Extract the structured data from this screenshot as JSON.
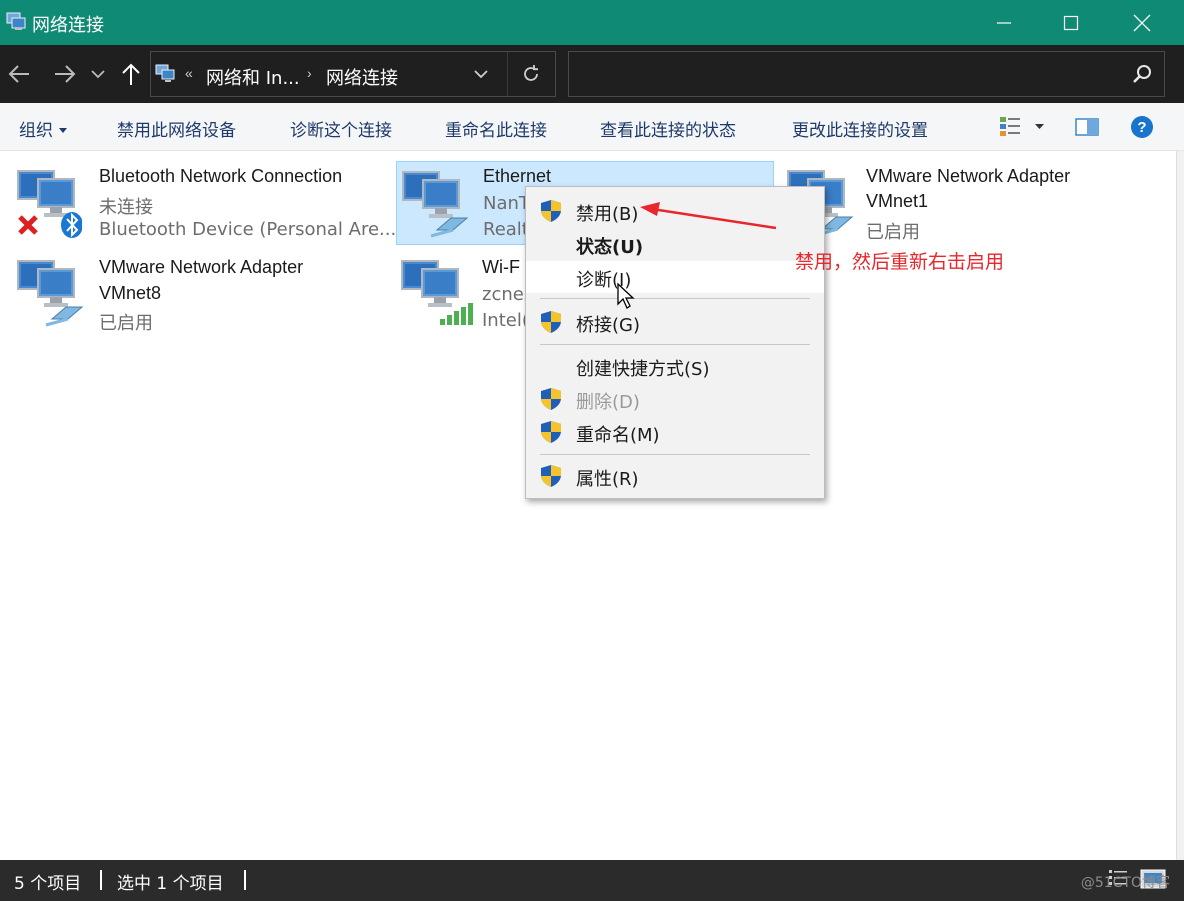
{
  "window": {
    "title": "网络连接",
    "accent": "#0f8a74"
  },
  "address": {
    "sep": "«",
    "segment1": "网络和 In...",
    "arrow": "›",
    "segment2": "网络连接",
    "search_placeholder": ""
  },
  "commands": {
    "organize": "组织",
    "disable_device": "禁用此网络设备",
    "diagnose": "诊断这个连接",
    "rename": "重命名此连接",
    "view_status": "查看此连接的状态",
    "change_settings": "更改此连接的设置"
  },
  "items": [
    {
      "name": "Bluetooth Network Connection",
      "status": "未连接",
      "device": "Bluetooth Device (Personal Are...",
      "icon": "bluetooth-network-icon"
    },
    {
      "name": "Ethernet",
      "status": "NanT",
      "device": "Realt",
      "icon": "ethernet-network-icon",
      "selected": true
    },
    {
      "name_line1": "VMware Network Adapter",
      "name_line2": "VMnet1",
      "status": "已启用",
      "icon": "vmware-network-icon"
    },
    {
      "name_line1": "VMware Network Adapter",
      "name_line2": "VMnet8",
      "status": "已启用",
      "icon": "vmware-network-icon"
    },
    {
      "name": "Wi-F",
      "status": "zcnes",
      "device": "Intel(",
      "icon": "wifi-network-icon"
    }
  ],
  "context_menu": {
    "disable": "禁用(B)",
    "status": "状态(U)",
    "diagnose": "诊断(I)",
    "bridge": "桥接(G)",
    "shortcut": "创建快捷方式(S)",
    "delete": "删除(D)",
    "rename": "重命名(M)",
    "properties": "属性(R)"
  },
  "annotation": {
    "text": "禁用，然后重新右击启用",
    "color": "#e8262b"
  },
  "status_bar": {
    "count": "5 个项目",
    "selected": "选中 1 个项目"
  },
  "watermark": "@51CTO博客"
}
